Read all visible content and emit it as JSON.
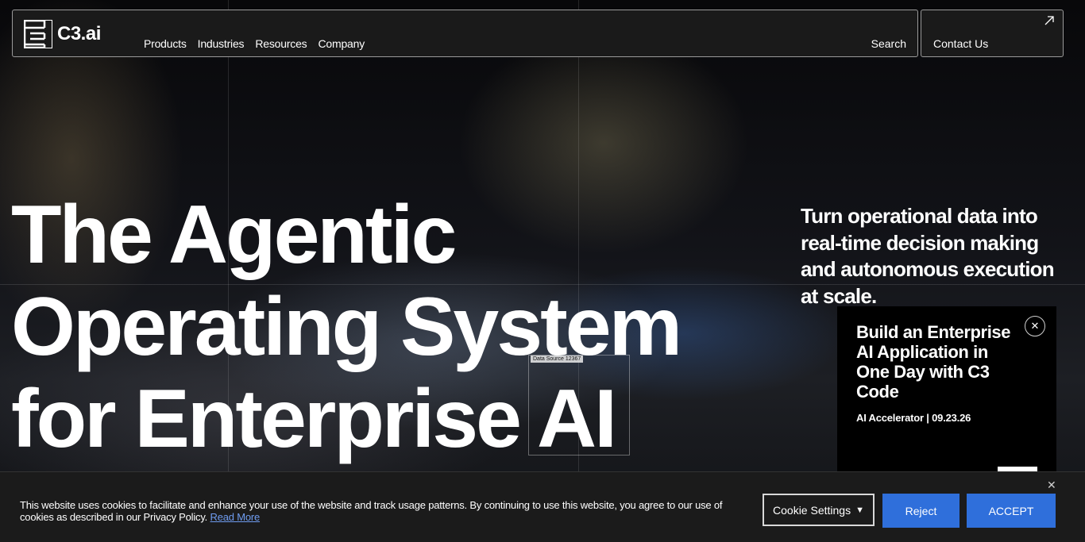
{
  "brand": {
    "name": "C3.ai"
  },
  "nav": {
    "links": [
      "Products",
      "Industries",
      "Resources",
      "Company"
    ],
    "search_label": "Search",
    "contact_label": "Contact Us"
  },
  "hero": {
    "headline_lines": [
      "The Agentic",
      "Operating System",
      "for Enterprise AI"
    ],
    "subheadline": "Turn operational data into real-time decision making and autonomous execution at scale.",
    "data_source_label": "Data Source 12367"
  },
  "promo": {
    "title": "Build an Enterprise AI Application in One Day with C3 Code",
    "meta": "AI Accelerator | 09.23.26",
    "close_glyph": "✕"
  },
  "cookie": {
    "text": "This website uses cookies to facilitate and enhance your use of the website and track usage patterns. By continuing to use this website, you agree to our use of cookies as described in our Privacy Policy.",
    "read_more": "Read More",
    "settings_label": "Cookie Settings",
    "reject_label": "Reject",
    "accept_label": "ACCEPT",
    "close_glyph": "✕"
  },
  "colors": {
    "accent_blue": "#2f6fdb",
    "link_blue": "#6f9cf0",
    "nav_bg": "#1a1a1a"
  },
  "icons": {
    "logo": "c3-logo-mark",
    "contact_arrow": "arrow-up-right-icon",
    "promo_close": "close-icon",
    "cookie_close": "close-icon",
    "settings_caret": "caret-down-icon"
  }
}
